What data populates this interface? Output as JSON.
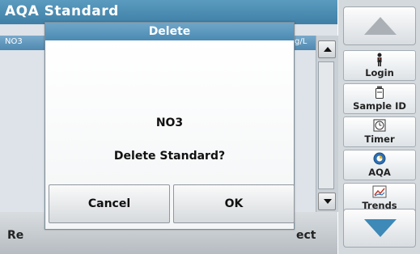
{
  "app": {
    "title": "AQA Standard",
    "column_left": "NO3",
    "column_right": "g/L"
  },
  "bottom_bar": {
    "left_label": "Re",
    "right_label": "ect"
  },
  "side_panel": {
    "items": [
      {
        "label": "Login",
        "icon": "person-icon"
      },
      {
        "label": "Sample ID",
        "icon": "sample-bottle-icon"
      },
      {
        "label": "Timer",
        "icon": "timer-icon"
      },
      {
        "label": "AQA",
        "icon": "aqa-icon"
      },
      {
        "label": "Trends",
        "icon": "trends-chart-icon"
      }
    ]
  },
  "dialog": {
    "title": "Delete",
    "line1": "NO3",
    "line2": "Delete Standard?",
    "cancel_label": "Cancel",
    "ok_label": "OK"
  },
  "colors": {
    "title_blue": "#4b8ab3",
    "down_arrow_blue": "#3d89b8",
    "panel_gray": "#d4d9dd"
  }
}
